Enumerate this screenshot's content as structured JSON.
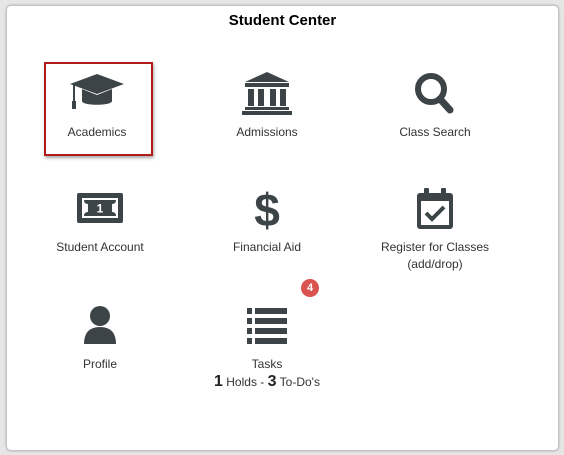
{
  "page": {
    "title": "Student Center"
  },
  "colors": {
    "icon": "#3d4447",
    "selected_border": "#b01c1c",
    "badge_bg": "#d9534f"
  },
  "tiles": [
    {
      "label": "Academics",
      "icon": "graduation-cap-icon",
      "selected": true
    },
    {
      "label": "Admissions",
      "icon": "institution-building-icon"
    },
    {
      "label": "Class Search",
      "icon": "magnifier-icon"
    },
    {
      "label": "Student Account",
      "icon": "money-bill-icon"
    },
    {
      "label": "Financial Aid",
      "icon": "dollar-sign-icon"
    },
    {
      "label_line1": "Register for Classes",
      "label_line2": "(add/drop)",
      "icon": "calendar-check-icon"
    },
    {
      "label": "Profile",
      "icon": "user-icon"
    },
    {
      "label": "Tasks",
      "icon": "list-icon",
      "badge": "4",
      "holds_count": "1",
      "holds_label": "Holds",
      "separator": "-",
      "todos_count": "3",
      "todos_label": "To-Do's"
    }
  ]
}
